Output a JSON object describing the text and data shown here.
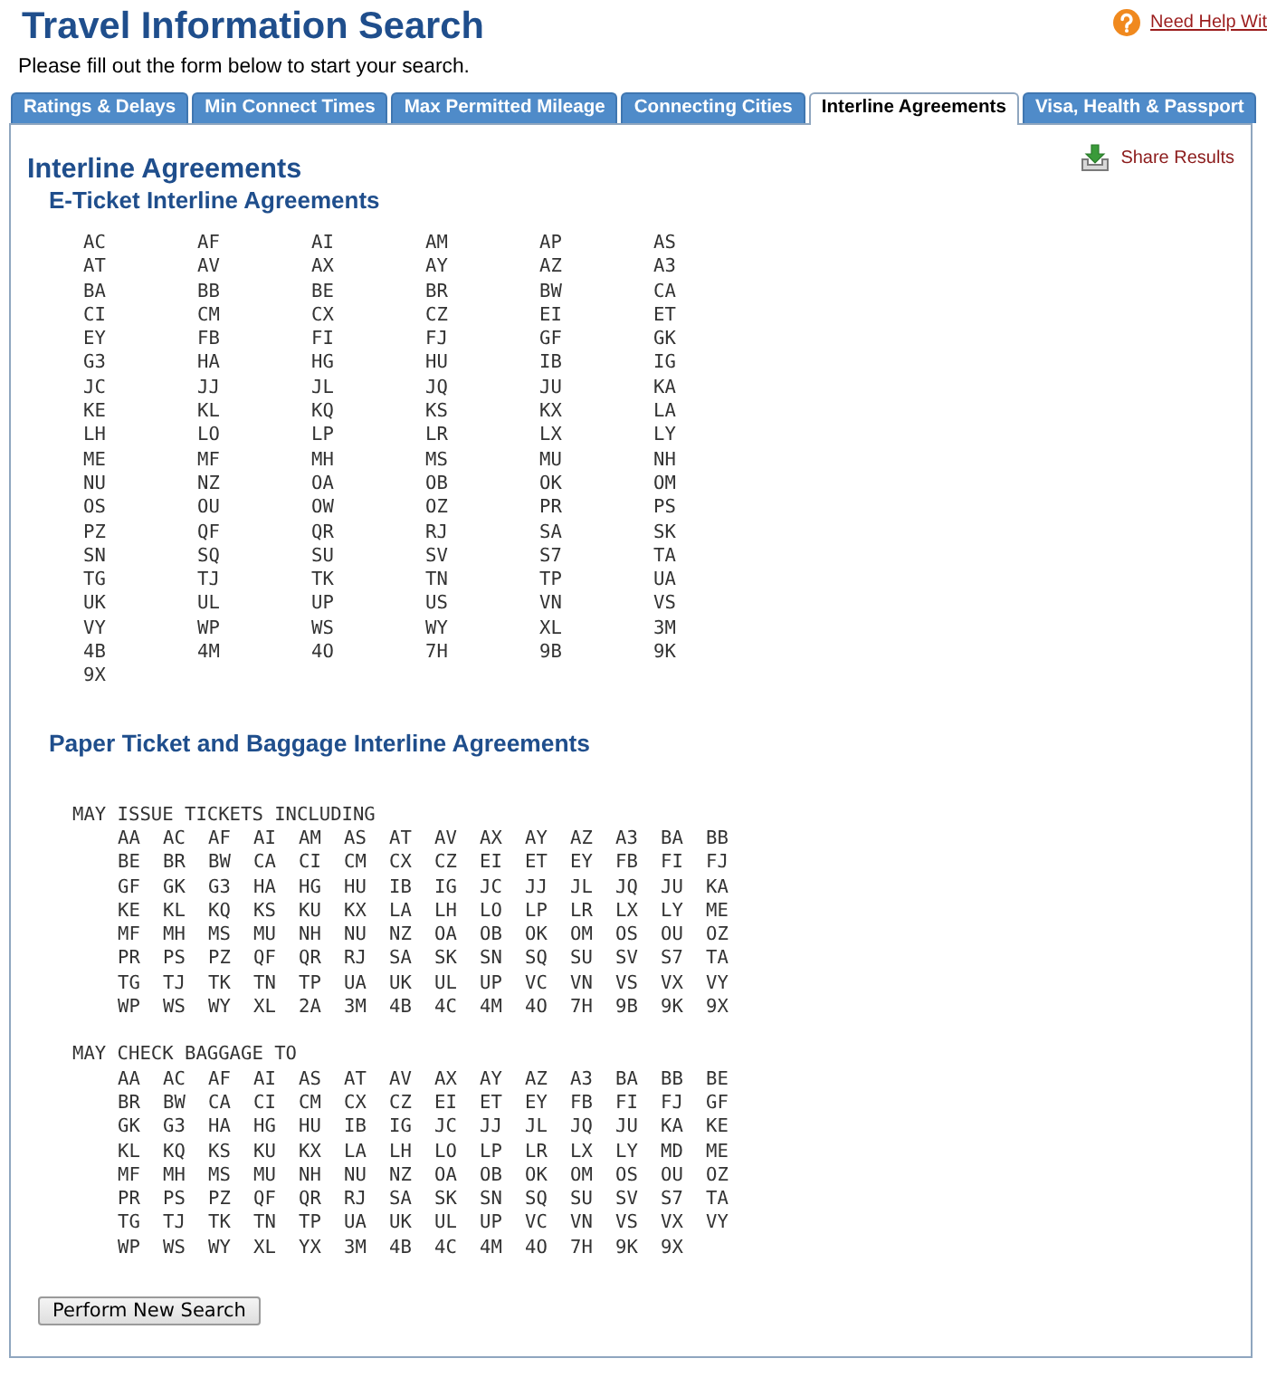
{
  "header": {
    "title": "Travel Information Search",
    "subtitle": "Please fill out the form below to start your search.",
    "help_link": "Need Help Wit"
  },
  "tabs": [
    {
      "label": "Ratings & Delays",
      "selected": false
    },
    {
      "label": "Min Connect Times",
      "selected": false
    },
    {
      "label": "Max Permitted Mileage",
      "selected": false
    },
    {
      "label": "Connecting Cities",
      "selected": false
    },
    {
      "label": "Interline Agreements",
      "selected": true
    },
    {
      "label": "Visa, Health & Passport",
      "selected": false
    }
  ],
  "panel": {
    "heading": "Interline Agreements",
    "share_link": "Share Results"
  },
  "e_ticket": {
    "heading": "E-Ticket Interline Agreements",
    "codes": [
      "AC",
      "AF",
      "AI",
      "AM",
      "AP",
      "AS",
      "AT",
      "AV",
      "AX",
      "AY",
      "AZ",
      "A3",
      "BA",
      "BB",
      "BE",
      "BR",
      "BW",
      "CA",
      "CI",
      "CM",
      "CX",
      "CZ",
      "EI",
      "ET",
      "EY",
      "FB",
      "FI",
      "FJ",
      "GF",
      "GK",
      "G3",
      "HA",
      "HG",
      "HU",
      "IB",
      "IG",
      "JC",
      "JJ",
      "JL",
      "JQ",
      "JU",
      "KA",
      "KE",
      "KL",
      "KQ",
      "KS",
      "KX",
      "LA",
      "LH",
      "LO",
      "LP",
      "LR",
      "LX",
      "LY",
      "ME",
      "MF",
      "MH",
      "MS",
      "MU",
      "NH",
      "NU",
      "NZ",
      "OA",
      "OB",
      "OK",
      "OM",
      "OS",
      "OU",
      "OW",
      "OZ",
      "PR",
      "PS",
      "PZ",
      "QF",
      "QR",
      "RJ",
      "SA",
      "SK",
      "SN",
      "SQ",
      "SU",
      "SV",
      "S7",
      "TA",
      "TG",
      "TJ",
      "TK",
      "TN",
      "TP",
      "UA",
      "UK",
      "UL",
      "UP",
      "US",
      "VN",
      "VS",
      "VY",
      "WP",
      "WS",
      "WY",
      "XL",
      "3M",
      "4B",
      "4M",
      "4O",
      "7H",
      "9B",
      "9K",
      "9X"
    ]
  },
  "paper": {
    "heading": "Paper Ticket and Baggage Interline Agreements",
    "groups": [
      {
        "label": "MAY ISSUE TICKETS INCLUDING",
        "codes": [
          "AA",
          "AC",
          "AF",
          "AI",
          "AM",
          "AS",
          "AT",
          "AV",
          "AX",
          "AY",
          "AZ",
          "A3",
          "BA",
          "BB",
          "BE",
          "BR",
          "BW",
          "CA",
          "CI",
          "CM",
          "CX",
          "CZ",
          "EI",
          "ET",
          "EY",
          "FB",
          "FI",
          "FJ",
          "GF",
          "GK",
          "G3",
          "HA",
          "HG",
          "HU",
          "IB",
          "IG",
          "JC",
          "JJ",
          "JL",
          "JQ",
          "JU",
          "KA",
          "KE",
          "KL",
          "KQ",
          "KS",
          "KU",
          "KX",
          "LA",
          "LH",
          "LO",
          "LP",
          "LR",
          "LX",
          "LY",
          "ME",
          "MF",
          "MH",
          "MS",
          "MU",
          "NH",
          "NU",
          "NZ",
          "OA",
          "OB",
          "OK",
          "OM",
          "OS",
          "OU",
          "OZ",
          "PR",
          "PS",
          "PZ",
          "QF",
          "QR",
          "RJ",
          "SA",
          "SK",
          "SN",
          "SQ",
          "SU",
          "SV",
          "S7",
          "TA",
          "TG",
          "TJ",
          "TK",
          "TN",
          "TP",
          "UA",
          "UK",
          "UL",
          "UP",
          "VC",
          "VN",
          "VS",
          "VX",
          "VY",
          "WP",
          "WS",
          "WY",
          "XL",
          "2A",
          "3M",
          "4B",
          "4C",
          "4M",
          "4O",
          "7H",
          "9B",
          "9K",
          "9X"
        ]
      },
      {
        "label": "MAY CHECK BAGGAGE TO",
        "codes": [
          "AA",
          "AC",
          "AF",
          "AI",
          "AS",
          "AT",
          "AV",
          "AX",
          "AY",
          "AZ",
          "A3",
          "BA",
          "BB",
          "BE",
          "BR",
          "BW",
          "CA",
          "CI",
          "CM",
          "CX",
          "CZ",
          "EI",
          "ET",
          "EY",
          "FB",
          "FI",
          "FJ",
          "GF",
          "GK",
          "G3",
          "HA",
          "HG",
          "HU",
          "IB",
          "IG",
          "JC",
          "JJ",
          "JL",
          "JQ",
          "JU",
          "KA",
          "KE",
          "KL",
          "KQ",
          "KS",
          "KU",
          "KX",
          "LA",
          "LH",
          "LO",
          "LP",
          "LR",
          "LX",
          "LY",
          "MD",
          "ME",
          "MF",
          "MH",
          "MS",
          "MU",
          "NH",
          "NU",
          "NZ",
          "OA",
          "OB",
          "OK",
          "OM",
          "OS",
          "OU",
          "OZ",
          "PR",
          "PS",
          "PZ",
          "QF",
          "QR",
          "RJ",
          "SA",
          "SK",
          "SN",
          "SQ",
          "SU",
          "SV",
          "S7",
          "TA",
          "TG",
          "TJ",
          "TK",
          "TN",
          "TP",
          "UA",
          "UK",
          "UL",
          "UP",
          "VC",
          "VN",
          "VS",
          "VX",
          "VY",
          "WP",
          "WS",
          "WY",
          "XL",
          "YX",
          "3M",
          "4B",
          "4C",
          "4M",
          "4O",
          "7H",
          "9K",
          "9X"
        ]
      }
    ]
  },
  "button": "Perform New Search"
}
